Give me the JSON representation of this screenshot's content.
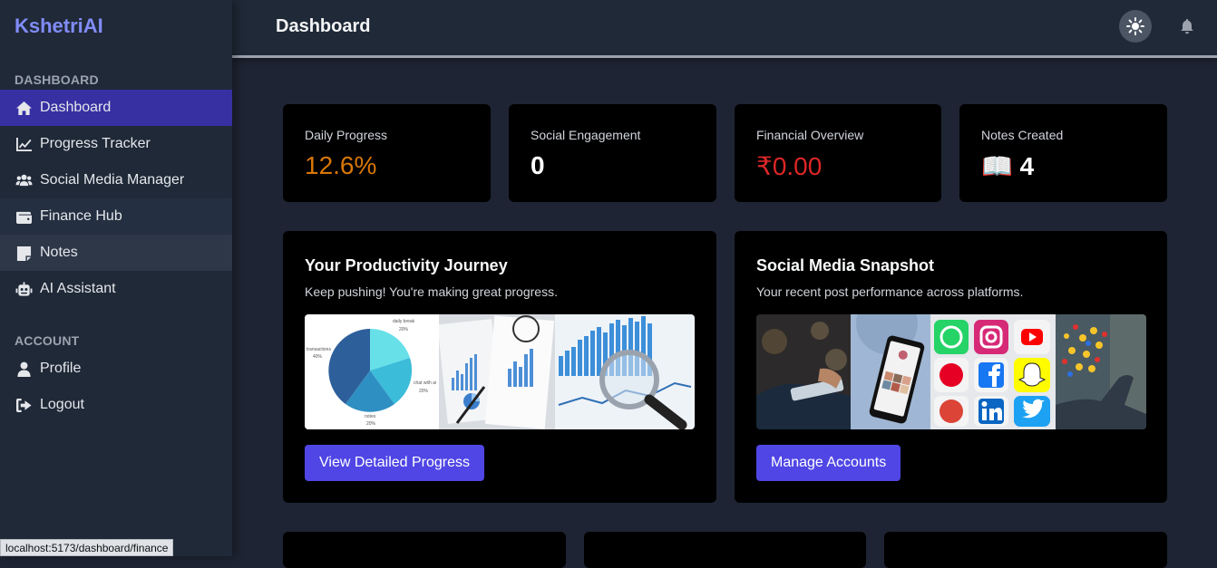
{
  "app": {
    "brand": "KshetriAI"
  },
  "sidebar": {
    "section_dashboard": "DASHBOARD",
    "section_account": "ACCOUNT",
    "items": [
      {
        "label": "Dashboard",
        "icon": "home-icon"
      },
      {
        "label": "Progress Tracker",
        "icon": "chart-line-icon"
      },
      {
        "label": "Social Media Manager",
        "icon": "users-icon"
      },
      {
        "label": "Finance Hub",
        "icon": "wallet-icon"
      },
      {
        "label": "Notes",
        "icon": "sticky-note-icon"
      },
      {
        "label": "AI Assistant",
        "icon": "robot-icon"
      }
    ],
    "account_items": [
      {
        "label": "Profile",
        "icon": "user-icon"
      },
      {
        "label": "Logout",
        "icon": "logout-icon"
      }
    ]
  },
  "header": {
    "title": "Dashboard"
  },
  "stats": [
    {
      "label": "Daily Progress",
      "value": "12.6%",
      "color": "#d97706"
    },
    {
      "label": "Social Engagement",
      "value": "0",
      "color": "#ffffff"
    },
    {
      "label": "Financial Overview",
      "value": "₹0.00",
      "color": "#dc2626"
    },
    {
      "label": "Notes Created",
      "value": "📖 4",
      "color": "#ffffff"
    }
  ],
  "productivity": {
    "title": "Your Productivity Journey",
    "subtitle": "Keep pushing! You're making great progress.",
    "button": "View Detailed Progress",
    "pie_labels": [
      "daily break",
      "20%",
      "transactions",
      "40%",
      "chat with ai",
      "20%",
      "notes",
      "20%"
    ]
  },
  "social": {
    "title": "Social Media Snapshot",
    "subtitle": "Your recent post performance across platforms.",
    "button": "Manage Accounts"
  },
  "status_bar": {
    "url": "localhost:5173/dashboard/finance"
  }
}
